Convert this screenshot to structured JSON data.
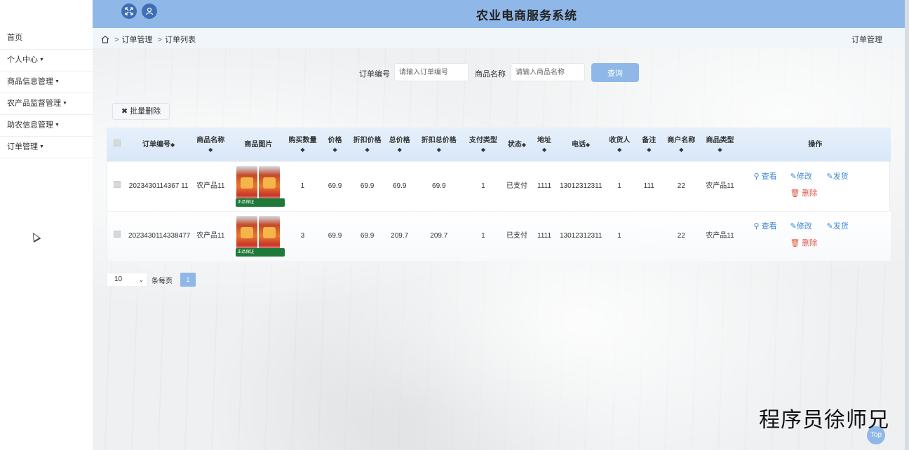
{
  "app": {
    "title": "农业电商服务系统"
  },
  "sidebar": {
    "items": [
      {
        "label": "首页",
        "has_caret": false
      },
      {
        "label": "个人中心",
        "has_caret": true
      },
      {
        "label": "商品信息管理",
        "has_caret": true
      },
      {
        "label": "农产品监督管理",
        "has_caret": true
      },
      {
        "label": "助农信息管理",
        "has_caret": true
      },
      {
        "label": "订单管理",
        "has_caret": true
      }
    ]
  },
  "breadcrumb": {
    "items": [
      "订单管理",
      "订单列表"
    ],
    "right": "订单管理"
  },
  "search": {
    "order_no_label": "订单编号",
    "order_no_placeholder": "请输入订单编号",
    "product_label": "商品名称",
    "product_placeholder": "请输入商品名称",
    "button": "查询"
  },
  "batch_delete": "批量删除",
  "table": {
    "columns": [
      "订单编号",
      "商品名称",
      "商品图片",
      "购买数量",
      "价格",
      "折扣价格",
      "总价格",
      "折扣总价格",
      "支付类型",
      "状态",
      "地址",
      "电话",
      "收货人",
      "备注",
      "商户名称",
      "商品类型",
      "操作"
    ],
    "rows": [
      {
        "order_no": "2023430114367 11",
        "product": "农产品11",
        "qty": "1",
        "price": "69.9",
        "discount_price": "69.9",
        "total": "69.9",
        "discount_total": "69.9",
        "pay_type": "1",
        "status": "已支付",
        "address": "1111",
        "phone": "13012312311",
        "receiver": "1",
        "remark": "111",
        "merchant": "22",
        "category": "农产品11"
      },
      {
        "order_no": "2023430114338477",
        "product": "农产品11",
        "qty": "3",
        "price": "69.9",
        "discount_price": "69.9",
        "total": "209.7",
        "discount_total": "209.7",
        "pay_type": "1",
        "status": "已支付",
        "address": "1111",
        "phone": "13012312311",
        "receiver": "1",
        "remark": "",
        "merchant": "22",
        "category": "农产品11"
      }
    ],
    "actions": {
      "view": "查看",
      "edit": "修改",
      "ship": "发货",
      "delete": "删除"
    },
    "image_tag": "正品保证"
  },
  "pager": {
    "page_size": "10",
    "page_size_label": "条每页",
    "current_page": "1"
  },
  "watermark": "程序员徐师兄",
  "top_button": "Top",
  "colors": {
    "header": "#8fb8e8",
    "accent": "#3d86d6",
    "danger": "#e05a4a"
  }
}
